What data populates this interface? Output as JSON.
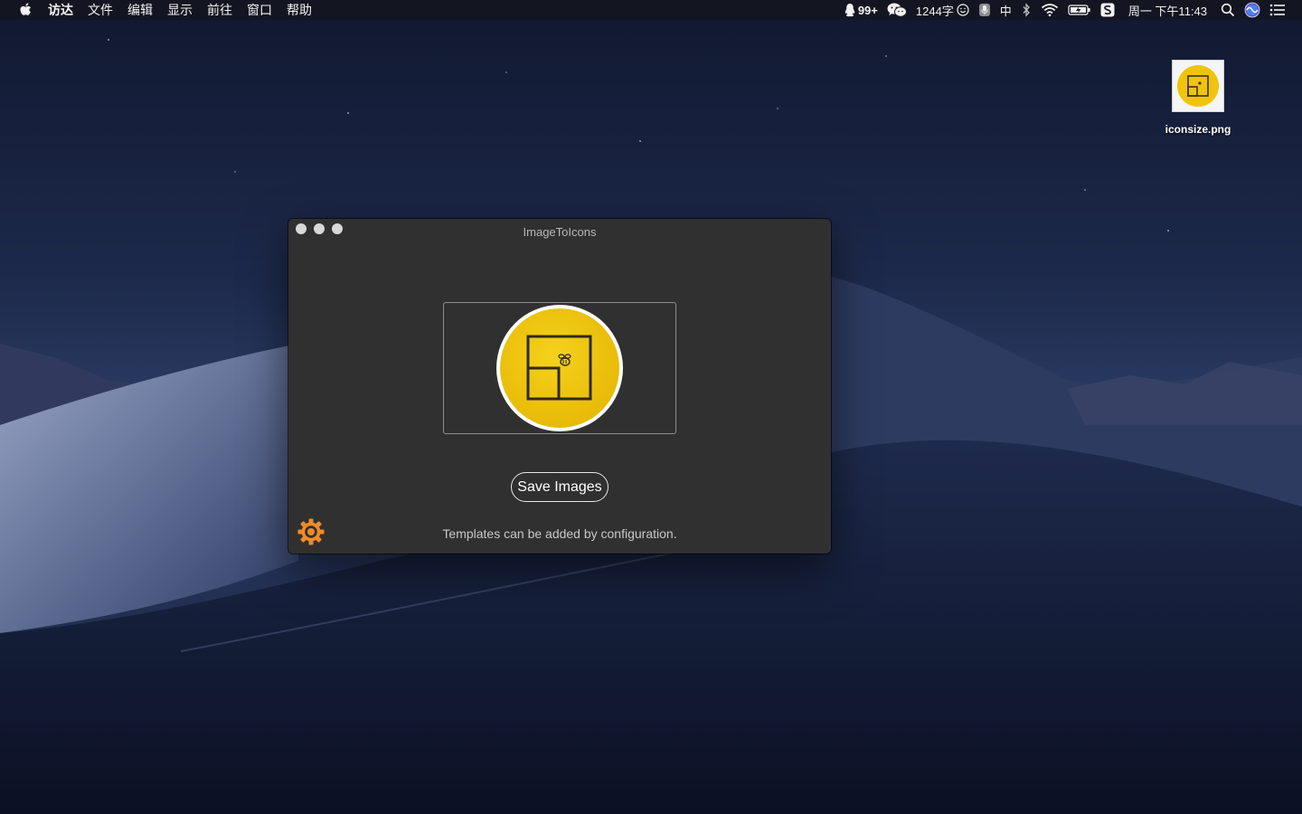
{
  "menubar": {
    "apple_icon": "apple-logo-icon",
    "items": [
      "访达",
      "文件",
      "编辑",
      "显示",
      "前往",
      "窗口",
      "帮助"
    ],
    "status": {
      "qq_badge": "99+",
      "word_count": "1244字",
      "input_method": "中",
      "datetime": "周一 下午11:43"
    }
  },
  "desktop": {
    "file_icon": {
      "filename": "iconsize.png"
    }
  },
  "window": {
    "title": "ImageToIcons",
    "save_button_label": "Save Images",
    "hint_text": "Templates can be added by configuration.",
    "accent_color": "#f0c40c",
    "settings_color": "#ef8a2a"
  }
}
